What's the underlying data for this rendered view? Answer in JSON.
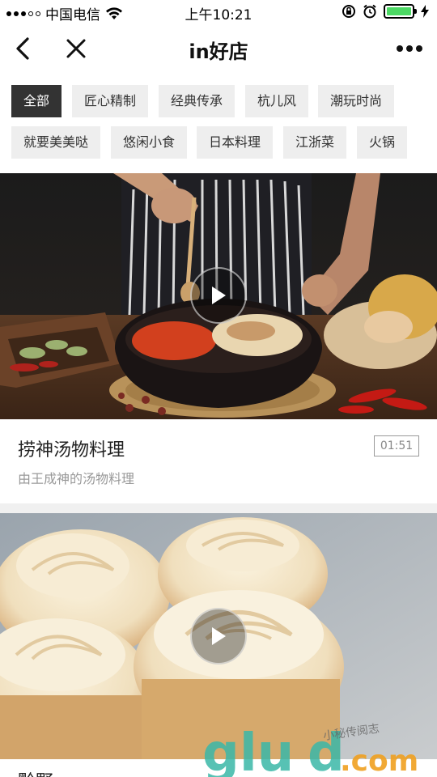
{
  "status_bar": {
    "carrier": "中国电信",
    "time": "上午10:21"
  },
  "nav": {
    "title": "in好店"
  },
  "tags": [
    {
      "label": "全部",
      "active": true
    },
    {
      "label": "匠心精制",
      "active": false
    },
    {
      "label": "经典传承",
      "active": false
    },
    {
      "label": "杭儿风",
      "active": false
    },
    {
      "label": "潮玩时尚",
      "active": false
    },
    {
      "label": "就要美美哒",
      "active": false
    },
    {
      "label": "悠闲小食",
      "active": false
    },
    {
      "label": "日本料理",
      "active": false
    },
    {
      "label": "江浙菜",
      "active": false
    },
    {
      "label": "火锅",
      "active": false
    }
  ],
  "cards": [
    {
      "title": "捞神汤物料理",
      "duration": "01:51",
      "subtitle": "由王成神的汤物料理"
    },
    {
      "title": "黔野",
      "duration": ""
    }
  ],
  "watermark": {
    "brand": "glud.com",
    "handwriting": "小秘传阅志"
  },
  "colors": {
    "active_tag_bg": "#333333",
    "tag_bg": "#eeeeee",
    "battery": "#4cd964"
  }
}
